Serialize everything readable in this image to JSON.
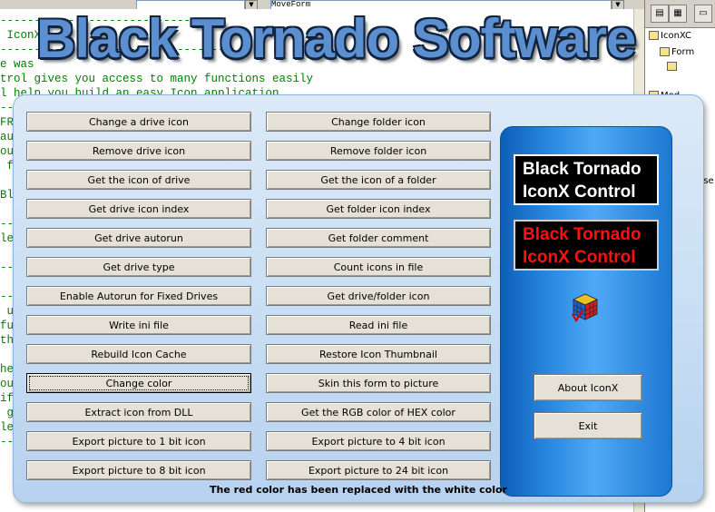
{
  "ide": {
    "object_combo": "",
    "proc_combo": "MoveForm",
    "code_lines": [
      "--------------------------------",
      " IconX ",
      "---------------------------------",
      "e was ",
      "trol gives you access to many functions easily",
      "l help you build an easy Icon application",
      "--",
      "FR",
      "au",
      "ou",
      " f",
      "",
      "Bl",
      "",
      "--",
      "le",
      "",
      "--",
      "",
      "--",
      " u",
      "fu",
      "th",
      "",
      "he",
      "ou",
      "if",
      " g",
      "le",
      "--"
    ],
    "tree_items": [
      "IconXC",
      "Form",
      "",
      "Mod",
      "Use"
    ]
  },
  "logo": "Black Tornado Software",
  "buttons_left": [
    "Change a drive icon",
    "Remove drive icon",
    "Get the icon of drive",
    "Get drive icon index",
    "Get drive autorun",
    "Get drive type",
    "Enable Autorun for Fixed Drives",
    "Write ini file",
    "Rebuild Icon Cache",
    "Change color",
    "Extract icon from DLL",
    "Export picture to 1 bit icon",
    "Export picture to 8 bit icon"
  ],
  "buttons_right": [
    "Change folder icon",
    "Remove folder icon",
    "Get the icon of a folder",
    "Get folder icon index",
    "Get folder comment",
    "Count icons in file",
    "Get drive/folder icon",
    "Read ini file",
    "Restore Icon Thumbnail",
    "Skin this form to picture",
    "Get the RGB color of HEX color",
    "Export picture to 4 bit icon",
    "Export picture to 24 bit icon"
  ],
  "side_panel": {
    "label_white": [
      "Black Tornado",
      "IconX Control"
    ],
    "label_red": [
      "Black Tornado",
      "IconX Control"
    ],
    "about_button": "About IconX",
    "exit_button": "Exit"
  },
  "status_text": "The red color has been replaced with the white color"
}
